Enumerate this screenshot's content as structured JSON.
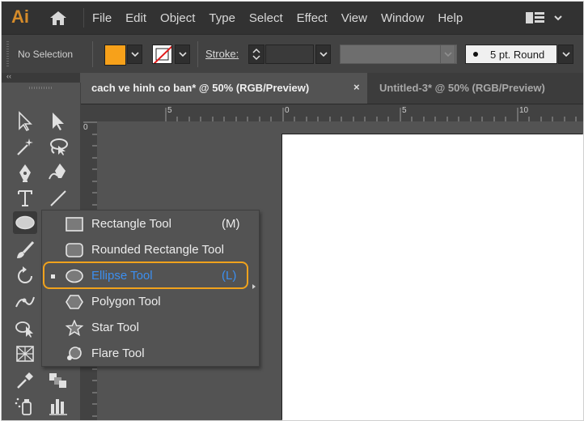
{
  "app": {
    "logo": "Ai"
  },
  "menu": {
    "items": [
      "File",
      "Edit",
      "Object",
      "Type",
      "Select",
      "Effect",
      "View",
      "Window",
      "Help"
    ]
  },
  "control_bar": {
    "selection_status": "No Selection",
    "fill_color": "#f7a11a",
    "stroke_label": "Stroke:",
    "brush_label": "5 pt. Round"
  },
  "panel": {
    "collapse_label": "‹‹"
  },
  "tabs": {
    "active": "cach ve hinh co ban* @ 50% (RGB/Preview)",
    "close_glyph": "×",
    "inactive": "Untitled-3* @ 50% (RGB/Preview)"
  },
  "ruler": {
    "h_labels": [
      "5",
      "0",
      "5",
      "10"
    ],
    "v_labels": [
      "0"
    ]
  },
  "flyout": {
    "items": [
      {
        "label": "Rectangle Tool",
        "shortcut": "(M)",
        "icon": "rectangle-icon"
      },
      {
        "label": "Rounded Rectangle Tool",
        "shortcut": "",
        "icon": "rounded-rectangle-icon"
      },
      {
        "label": "Ellipse Tool",
        "shortcut": "(L)",
        "icon": "ellipse-icon",
        "selected": true
      },
      {
        "label": "Polygon Tool",
        "shortcut": "",
        "icon": "polygon-icon"
      },
      {
        "label": "Star Tool",
        "shortcut": "",
        "icon": "star-icon"
      },
      {
        "label": "Flare Tool",
        "shortcut": "",
        "icon": "flare-icon"
      }
    ]
  },
  "colors": {
    "accent_highlight": "#f0a21c",
    "selected_text": "#3c8ff0",
    "logo": "#d58b2a"
  }
}
